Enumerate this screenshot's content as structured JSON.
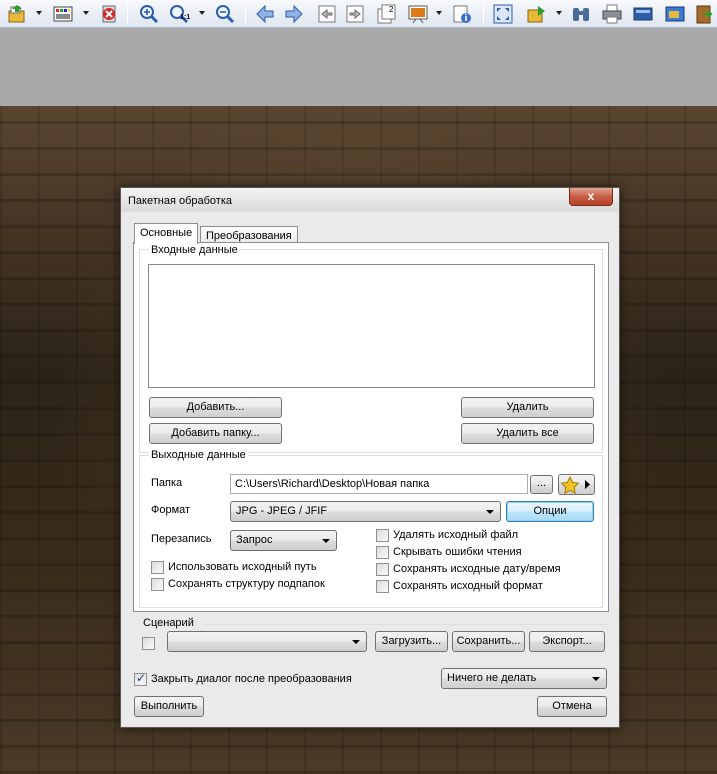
{
  "toolbar": {
    "icons": [
      "open-icon",
      "palette-icon",
      "delete-icon",
      "zoom-in-icon",
      "zoom-actual-icon",
      "zoom-out-icon",
      "arrow-left-icon",
      "arrow-right-icon",
      "prev-page-icon",
      "next-page-icon",
      "page-number-icon",
      "slideshow-icon",
      "info-icon",
      "fit-screen-icon",
      "copy-to-icon",
      "binoculars-icon",
      "print-icon",
      "scanner-icon",
      "screenshot-icon",
      "exit-icon"
    ],
    "zoom_actual_label": "1:1",
    "page_number_label": "2"
  },
  "dialog": {
    "title": "Пакетная обработка",
    "close_label": "x",
    "tabs": [
      {
        "label": "Основные",
        "active": true
      },
      {
        "label": "Преобразования",
        "active": false
      }
    ],
    "input": {
      "group_label": "Входные данные",
      "files": [],
      "add_label": "Добавить...",
      "add_folder_label": "Добавить папку...",
      "remove_label": "Удалить",
      "remove_all_label": "Удалить все"
    },
    "output": {
      "group_label": "Выходные данные",
      "folder_label": "Папка",
      "folder_value": "C:\\Users\\Richard\\Desktop\\Новая папка",
      "browse_label": "...",
      "format_label": "Формат",
      "format_value": "JPG - JPEG / JFIF",
      "options_label": "Опции",
      "overwrite_label": "Перезапись",
      "overwrite_value": "Запрос",
      "checkboxes_left": [
        {
          "label": "Использовать исходный путь",
          "checked": false
        },
        {
          "label": "Сохранять структуру подпапок",
          "checked": false
        }
      ],
      "checkboxes_right": [
        {
          "label": "Удалять исходный файл",
          "checked": false
        },
        {
          "label": "Скрывать ошибки чтения",
          "checked": false
        },
        {
          "label": "Сохранять исходные дату/время",
          "checked": false
        },
        {
          "label": "Сохранять исходный формат",
          "checked": false
        }
      ]
    },
    "scenario": {
      "group_label": "Сценарий",
      "checked": false,
      "value": "",
      "load_label": "Загрузить...",
      "save_label": "Сохранить...",
      "export_label": "Экспорт..."
    },
    "close_after": {
      "label": "Закрыть диалог после преобразования",
      "checked": true
    },
    "after_action_value": "Ничего не делать",
    "run_label": "Выполнить",
    "cancel_label": "Отмена"
  }
}
